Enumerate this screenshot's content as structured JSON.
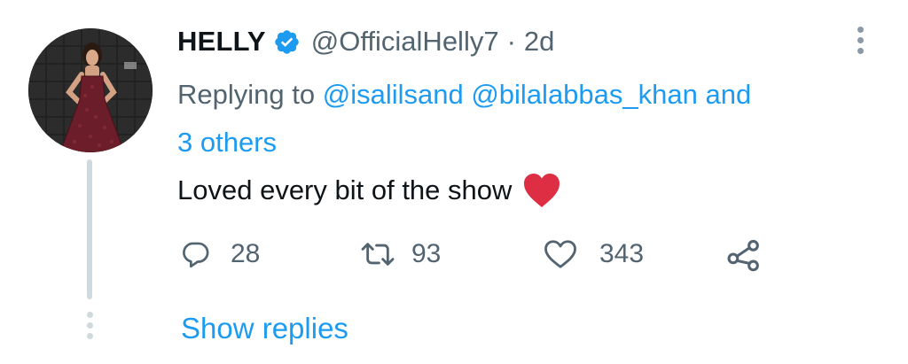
{
  "tweet": {
    "display_name": "HELLY",
    "handle": "@OfficialHelly7",
    "separator": "·",
    "time": "2d",
    "replying_prefix": "Replying to",
    "mention_1": "@isalilsand",
    "mention_2": "@bilalabbas_khan",
    "mention_joiner": "and",
    "others": "3 others",
    "text": "Loved every bit of the show",
    "emoji": "red-heart"
  },
  "actions": {
    "reply_count": "28",
    "retweet_count": "93",
    "like_count": "343"
  },
  "thread": {
    "show_replies_label": "Show replies"
  },
  "icons": {
    "verified": "verified-badge-icon",
    "more": "more-vertical-icon",
    "reply": "reply-bubble-icon",
    "retweet": "retweet-icon",
    "like": "heart-outline-icon",
    "share": "share-icon"
  },
  "colors": {
    "accent": "#1d9bf0",
    "text_primary": "#0f1419",
    "text_secondary": "#536471",
    "thread_line": "#cfd9de",
    "heart_emoji": "#dd2e44"
  }
}
